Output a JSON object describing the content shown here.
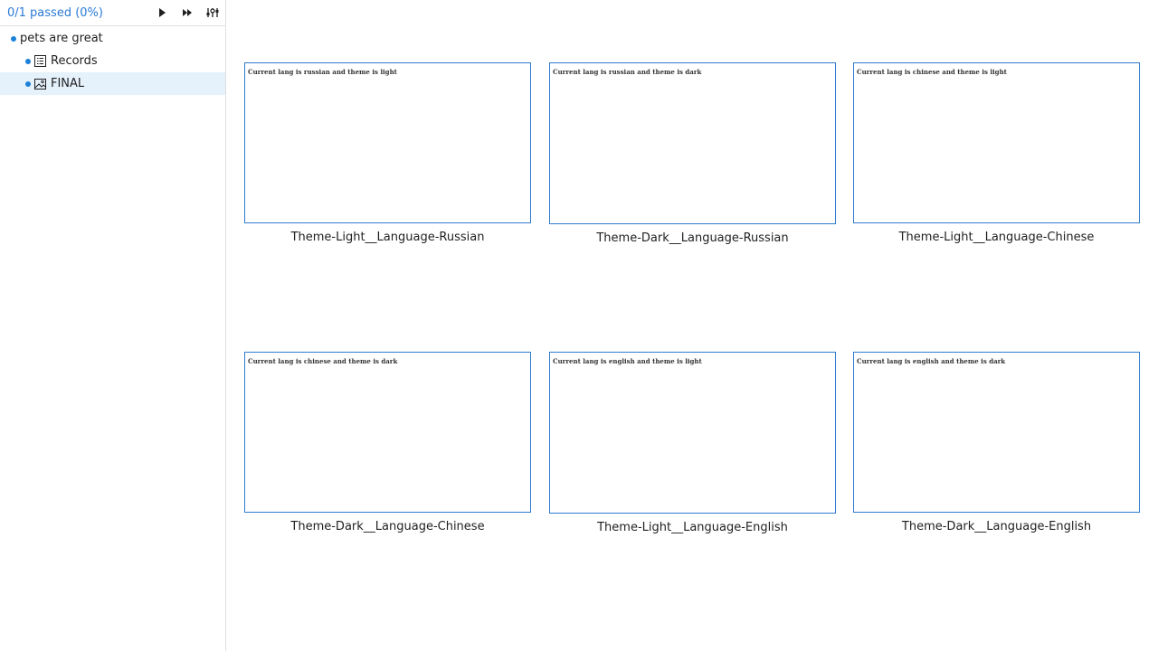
{
  "sidebar": {
    "status": "0/1 passed (0%)",
    "toolbar_icons": [
      "play-icon",
      "fast-forward-icon",
      "settings-sliders-icon"
    ],
    "tree": {
      "root_label": "pets are great",
      "records_label": "Records",
      "final_label": "FINAL"
    }
  },
  "gallery": {
    "items": [
      {
        "caption": "Theme-Light__Language-Russian",
        "thumb_text": "Current lang is russian and theme is light"
      },
      {
        "caption": "Theme-Dark__Language-Russian",
        "thumb_text": "Current lang is russian and theme is dark"
      },
      {
        "caption": "Theme-Light__Language-Chinese",
        "thumb_text": "Current lang is chinese and theme is light"
      },
      {
        "caption": "Theme-Dark__Language-Chinese",
        "thumb_text": "Current lang is chinese and theme is dark"
      },
      {
        "caption": "Theme-Light__Language-English",
        "thumb_text": "Current lang is english and theme is light"
      },
      {
        "caption": "Theme-Dark__Language-English",
        "thumb_text": "Current lang is english and theme is dark"
      }
    ]
  },
  "colors": {
    "accent": "#2b7bd6",
    "dot": "#1c82d8",
    "selected_bg": "#e5f1fb",
    "thumb_border": "#2f7bd0"
  }
}
